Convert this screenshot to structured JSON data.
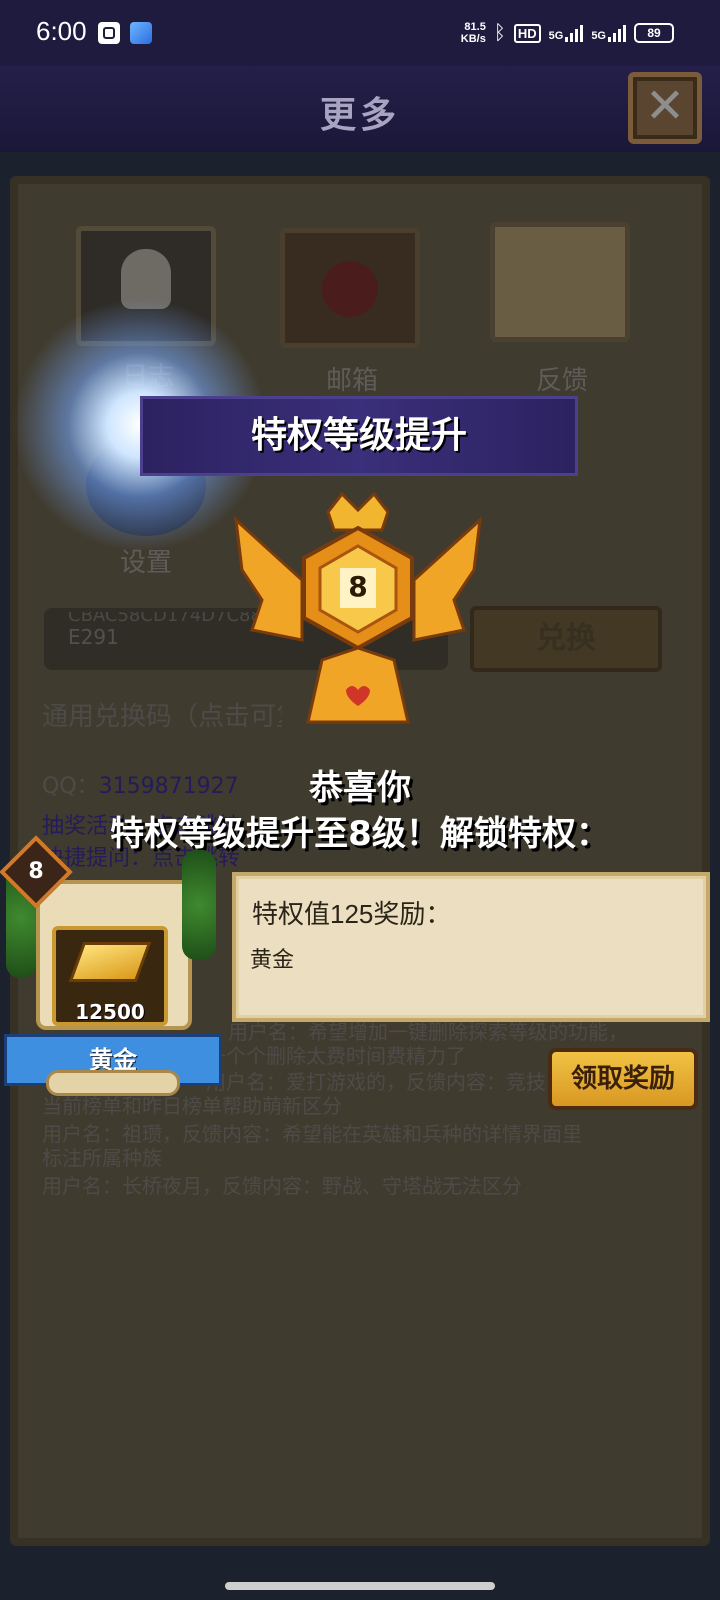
{
  "status_bar": {
    "time": "6:00",
    "net_speed_top": "81.5",
    "net_speed_bottom": "KB/s",
    "hd_label": "HD",
    "net1": "5G",
    "net2": "5G",
    "battery": "89"
  },
  "header": {
    "title": "更多",
    "close_icon": "close-x-icon"
  },
  "menu": {
    "items": [
      {
        "label": "日志",
        "icon": "skull-book-icon"
      },
      {
        "label": "邮箱",
        "icon": "sealed-letter-icon"
      },
      {
        "label": "反馈",
        "icon": "scroll-icon"
      },
      {
        "label": "设置",
        "icon": "gear-icon"
      }
    ]
  },
  "redeem": {
    "code_line1": "CBAC58CD174D7C88D",
    "code_line2": "E291",
    "button_label": "兑换",
    "note": "通用兑换码（点击可复制）"
  },
  "background_text": {
    "qq_label": "QQ：",
    "qq_number": "3159871927",
    "line_a": "抽奖活动：点击跳转",
    "line_b": "快捷提问：点击跳转",
    "feedback_1": "用户名：希望增加一键删除探索等级的功能，",
    "feedback_1b": "一个个删除太费时间费精力了",
    "feedback_2": "用户名：爱打游戏的，反馈内容：竞技场榜单能否区分",
    "feedback_2b": "当前榜单和昨日榜单帮助萌新区分",
    "feedback_3": "用户名：祖瓒，反馈内容：希望能在英雄和兵种的详情界面里",
    "feedback_3b": "标注所属种族",
    "feedback_4": "用户名：长桥夜月，反馈内容：野战、守塔战无法区分"
  },
  "popup": {
    "banner": "特权等级提升",
    "badge_level": "8",
    "congrats": "恭喜你",
    "unlock_text": "特权等级提升至8级！解锁特权：",
    "reward": {
      "level": "8",
      "quantity": "12500",
      "name": "黄金",
      "icon": "gold-bar-icon"
    },
    "desc_title": "特权值125奖励：",
    "desc_item": "黄金",
    "claim_button": "领取奖励"
  },
  "colors": {
    "banner": "#3a2f7a",
    "gold": "#f1c244",
    "parchment": "#ecdfc1",
    "statusbar": "#1f1b3f"
  }
}
